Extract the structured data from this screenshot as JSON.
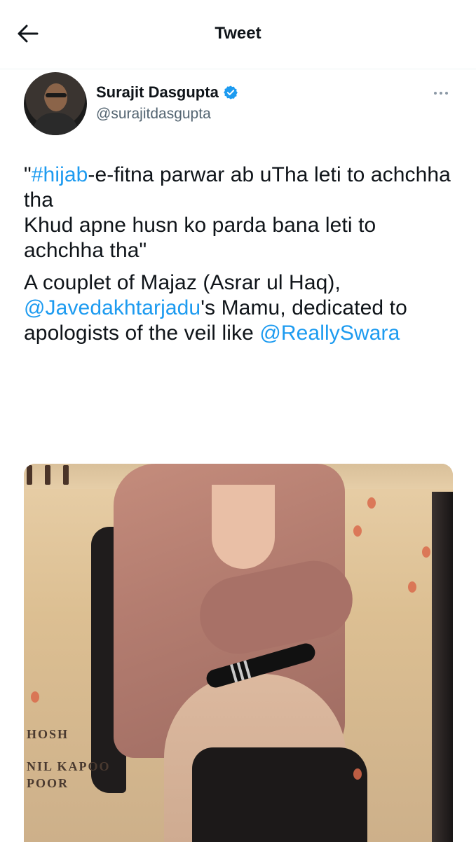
{
  "header": {
    "title": "Tweet",
    "back_icon": "arrow-left-icon"
  },
  "author": {
    "name": "Surajit Dasgupta",
    "handle": "@surajitdasgupta",
    "verified_icon": "verified-badge-icon",
    "more_icon": "more-horizontal-icon"
  },
  "tweet": {
    "quote_open": "\"",
    "hashtag": "#hijab",
    "line1_rest": "-e-fitna parwar ab uTha leti to achchha tha",
    "line2": "Khud apne husn ko parda bana leti to achchha tha\"",
    "p2_intro": "A couplet of Majaz (Asrar ul Haq),",
    "mention1": "@Javedakhtarjadu",
    "p2_mid": "'s Mamu, dedicated to apologists of the veil like",
    "mention2": "@ReallySwara"
  },
  "media": {
    "poster_text_1": "HOSH",
    "poster_text_2": "NIL KAPOO",
    "poster_text_3": "POOR"
  },
  "colors": {
    "link": "#1d9bf0",
    "verified": "#1d9bf0",
    "secondary_text": "#536471"
  }
}
